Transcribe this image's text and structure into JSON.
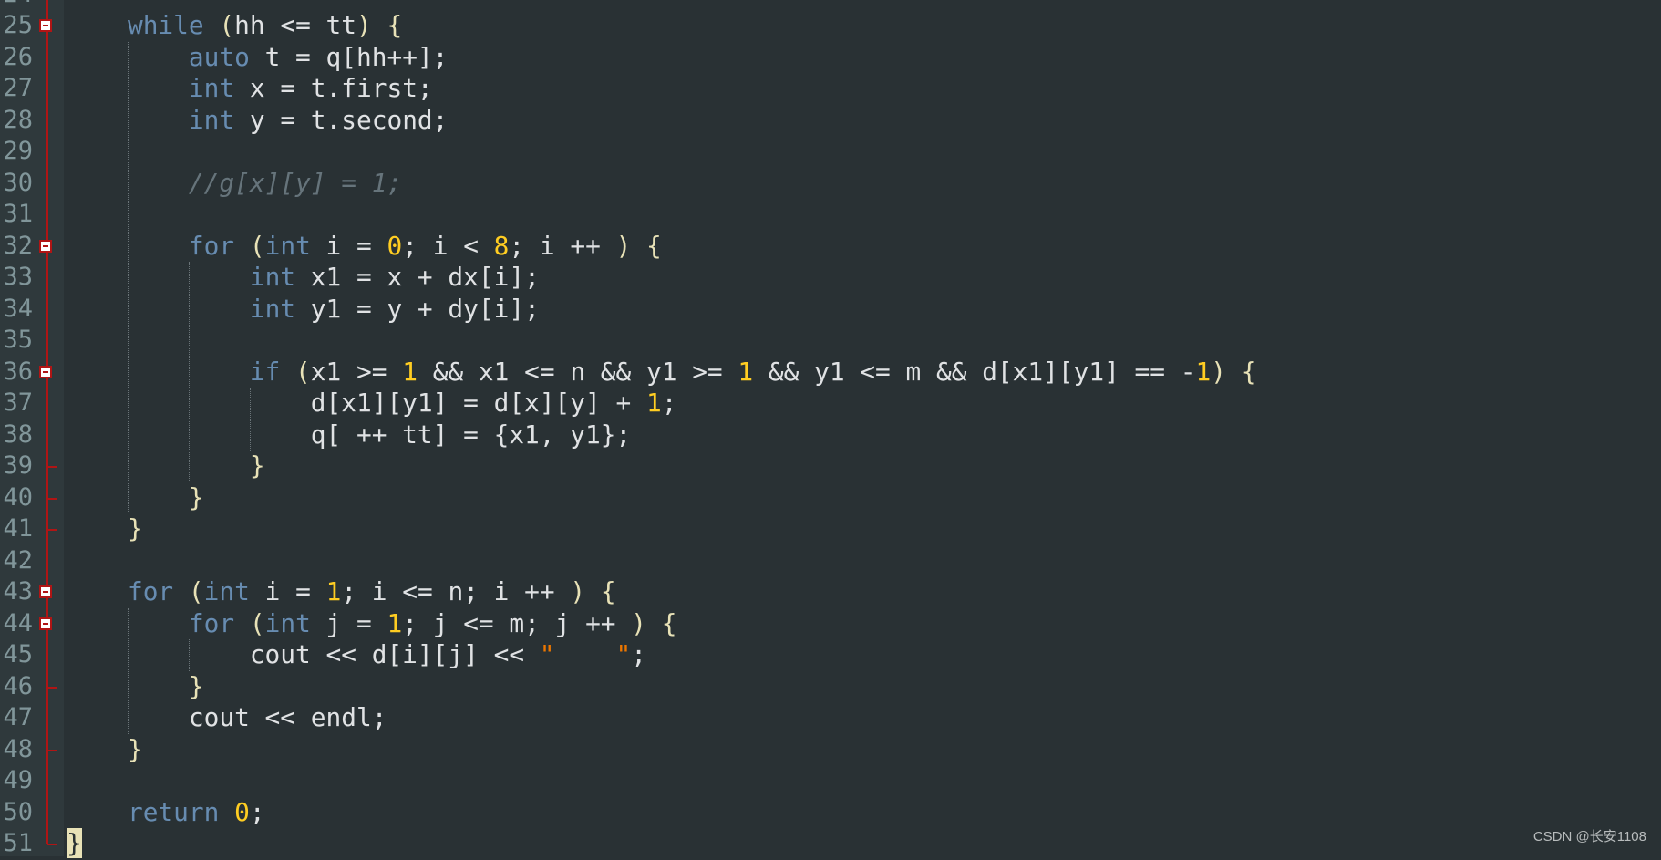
{
  "editor": {
    "first_partial_line": "24",
    "lines": [
      {
        "n": "25",
        "fold": "open",
        "t": [
          [
            "",
            "    "
          ],
          [
            "kw",
            "while"
          ],
          [
            "br",
            " ("
          ],
          [
            "",
            "hh <= tt"
          ],
          [
            "br",
            ") {"
          ]
        ]
      },
      {
        "n": "26",
        "t": [
          [
            "",
            "        "
          ],
          [
            "kw",
            "auto"
          ],
          [
            "",
            " t = q[hh++];"
          ]
        ]
      },
      {
        "n": "27",
        "t": [
          [
            "",
            "        "
          ],
          [
            "kw",
            "int"
          ],
          [
            "",
            " x = t.first;"
          ]
        ]
      },
      {
        "n": "28",
        "t": [
          [
            "",
            "        "
          ],
          [
            "kw",
            "int"
          ],
          [
            "",
            " y = t.second;"
          ]
        ]
      },
      {
        "n": "29",
        "t": []
      },
      {
        "n": "30",
        "t": [
          [
            "",
            "        "
          ],
          [
            "cm",
            "//g[x][y] = 1;"
          ]
        ]
      },
      {
        "n": "31",
        "t": []
      },
      {
        "n": "32",
        "fold": "open",
        "t": [
          [
            "",
            "        "
          ],
          [
            "kw",
            "for"
          ],
          [
            "br",
            " ("
          ],
          [
            "kw",
            "int"
          ],
          [
            "",
            " i = "
          ],
          [
            "num",
            "0"
          ],
          [
            "",
            "; i < "
          ],
          [
            "num",
            "8"
          ],
          [
            "",
            "; i ++ "
          ],
          [
            "br",
            ") {"
          ]
        ]
      },
      {
        "n": "33",
        "t": [
          [
            "",
            "            "
          ],
          [
            "kw",
            "int"
          ],
          [
            "",
            " x1 = x + dx[i];"
          ]
        ]
      },
      {
        "n": "34",
        "t": [
          [
            "",
            "            "
          ],
          [
            "kw",
            "int"
          ],
          [
            "",
            " y1 = y + dy[i];"
          ]
        ]
      },
      {
        "n": "35",
        "t": []
      },
      {
        "n": "36",
        "fold": "open",
        "t": [
          [
            "",
            "            "
          ],
          [
            "kw",
            "if"
          ],
          [
            "br",
            " ("
          ],
          [
            "",
            "x1 >= "
          ],
          [
            "num",
            "1"
          ],
          [
            "",
            " && x1 <= n && y1 >= "
          ],
          [
            "num",
            "1"
          ],
          [
            "",
            " && y1 <= m && d[x1][y1] == -"
          ],
          [
            "num",
            "1"
          ],
          [
            "br",
            ") {"
          ]
        ]
      },
      {
        "n": "37",
        "t": [
          [
            "",
            "                d[x1][y1] = d[x][y] + "
          ],
          [
            "num",
            "1"
          ],
          [
            "",
            ";"
          ]
        ]
      },
      {
        "n": "38",
        "t": [
          [
            "",
            "                q[ ++ tt] = {x1, y1};"
          ]
        ]
      },
      {
        "n": "39",
        "fold": "end",
        "t": [
          [
            "",
            "            "
          ],
          [
            "br",
            "}"
          ]
        ]
      },
      {
        "n": "40",
        "fold": "end",
        "t": [
          [
            "",
            "        "
          ],
          [
            "br",
            "}"
          ]
        ]
      },
      {
        "n": "41",
        "fold": "end",
        "t": [
          [
            "",
            "    "
          ],
          [
            "br",
            "}"
          ]
        ]
      },
      {
        "n": "42",
        "t": []
      },
      {
        "n": "43",
        "fold": "open",
        "t": [
          [
            "",
            "    "
          ],
          [
            "kw",
            "for"
          ],
          [
            "br",
            " ("
          ],
          [
            "kw",
            "int"
          ],
          [
            "",
            " i = "
          ],
          [
            "num",
            "1"
          ],
          [
            "",
            "; i <= n; i ++ "
          ],
          [
            "br",
            ") {"
          ]
        ]
      },
      {
        "n": "44",
        "fold": "open",
        "t": [
          [
            "",
            "        "
          ],
          [
            "kw",
            "for"
          ],
          [
            "br",
            " ("
          ],
          [
            "kw",
            "int"
          ],
          [
            "",
            " j = "
          ],
          [
            "num",
            "1"
          ],
          [
            "",
            "; j <= m; j ++ "
          ],
          [
            "br",
            ") {"
          ]
        ]
      },
      {
        "n": "45",
        "t": [
          [
            "",
            "            cout << d[i][j] << "
          ],
          [
            "str",
            "\"    \""
          ],
          [
            "",
            ";"
          ]
        ]
      },
      {
        "n": "46",
        "fold": "end",
        "t": [
          [
            "",
            "        "
          ],
          [
            "br",
            "}"
          ]
        ]
      },
      {
        "n": "47",
        "t": [
          [
            "",
            "        cout << endl;"
          ]
        ]
      },
      {
        "n": "48",
        "fold": "end",
        "t": [
          [
            "",
            "    "
          ],
          [
            "br",
            "}"
          ]
        ]
      },
      {
        "n": "49",
        "t": []
      },
      {
        "n": "50",
        "t": [
          [
            "",
            "    "
          ],
          [
            "kw",
            "return"
          ],
          [
            "",
            " "
          ],
          [
            "num",
            "0"
          ],
          [
            "",
            ";"
          ]
        ]
      },
      {
        "n": "51",
        "fold": "end",
        "t": [
          [
            "hl",
            "}"
          ]
        ]
      }
    ]
  },
  "watermark": "CSDN @长安1108",
  "colors": {
    "background": "#293134",
    "keyword": "#678cb1",
    "number": "#ffcd22",
    "comment": "#66747b",
    "fold_marker": "#b01515"
  }
}
